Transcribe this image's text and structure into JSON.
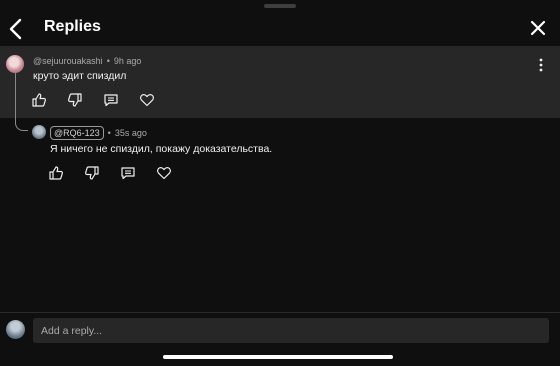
{
  "header": {
    "title": "Replies",
    "back_icon": "chevron-left-icon",
    "close_icon": "close-icon"
  },
  "parent_comment": {
    "author": "@sejuurouakashi",
    "time": "9h ago",
    "text": "круто эдит спиздил",
    "avatar_color": "#c98f9a"
  },
  "reply_comment": {
    "author": "@RQ6-123",
    "time": "35s ago",
    "text": "Я ничего не спиздил, покажу доказательства.",
    "avatar_color": "#708090"
  },
  "actions": [
    "like-icon",
    "dislike-icon",
    "reply-icon",
    "heart-icon"
  ],
  "composer": {
    "placeholder": "Add a reply..."
  },
  "colors": {
    "background": "#0f0f0f",
    "highlight": "#272727",
    "text": "#f1f1f1",
    "muted": "#aaaaaa"
  }
}
